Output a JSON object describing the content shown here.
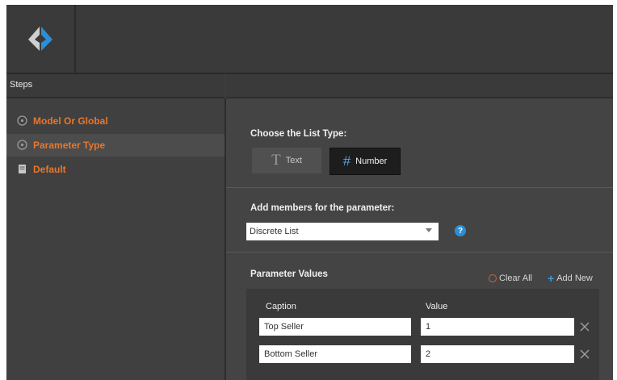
{
  "app": {
    "logo_icon": "app-logo-icon"
  },
  "steps": {
    "title": "Steps",
    "items": [
      {
        "label": "Model Or Global",
        "icon": "circle-icon",
        "active": false
      },
      {
        "label": "Parameter Type",
        "icon": "circle-icon",
        "active": true
      },
      {
        "label": "Default",
        "icon": "document-icon",
        "active": false
      }
    ]
  },
  "list_type": {
    "title": "Choose the List Type:",
    "options": [
      {
        "label": "Text",
        "icon": "text-T-icon",
        "selected": false
      },
      {
        "label": "Number",
        "icon": "hash-icon",
        "selected": true
      }
    ]
  },
  "members": {
    "title": "Add members for the parameter:",
    "selected": "Discrete List",
    "help_icon": "?"
  },
  "values": {
    "title": "Parameter Values",
    "clear_all": "Clear All",
    "add_new": "Add New",
    "columns": [
      "Caption",
      "Value"
    ],
    "rows": [
      {
        "caption": "Top Seller",
        "value": "1"
      },
      {
        "caption": "Bottom Seller",
        "value": "2"
      }
    ]
  },
  "colors": {
    "accent_orange": "#e8772d",
    "accent_blue": "#2a8fd7",
    "clear_red": "#e05a3a"
  }
}
